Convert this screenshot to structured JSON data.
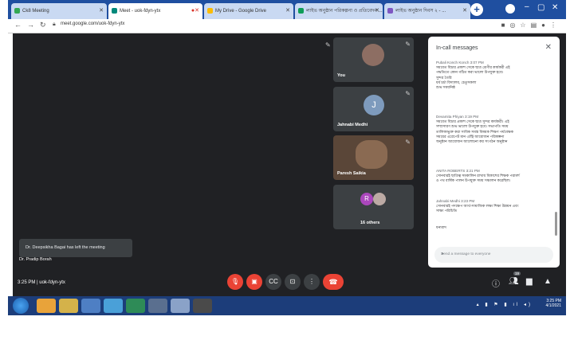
{
  "browser": {
    "tabs": [
      {
        "label": "Ck8 Meeting",
        "active": false,
        "favicon_color": "#34a853"
      },
      {
        "label": "Meet - uok-fdyn-ytx",
        "active": true,
        "favicon_color": "#00897b"
      },
      {
        "label": "My Drive - Google Drive",
        "active": false,
        "favicon_color": "#fbbc04"
      },
      {
        "label": "লাইভ অনুষ্ঠান পরিকল্পনা ও প্রতিবেদন ...",
        "active": false,
        "favicon_color": "#0f9d58"
      },
      {
        "label": "লাইভ অনুষ্ঠান দিবস ২ - ...",
        "active": false,
        "favicon_color": "#7e57c2"
      }
    ],
    "url": "meet.google.com/uok-fdyn-ytx"
  },
  "meet": {
    "tiles": [
      {
        "name": "You",
        "avatar_color": "#8d6e63"
      },
      {
        "name": "Jahnabi Medhi",
        "initial": "J",
        "avatar_color": "#7e9bbd"
      },
      {
        "name": "Paresh Saikia",
        "avatar_color": "#6d4c41"
      },
      {
        "name": "16 others",
        "initial": "R",
        "avatar_color": "#ab47bc"
      }
    ],
    "toast": "Dr. Deepsikha Bagai has left the meeting",
    "presenter": "Dr. Pradip Borah",
    "time_code": "3:25 PM  |  uok-fdyn-ytx",
    "people_count": "19"
  },
  "chat": {
    "title": "In-call messages",
    "messages": [
      {
        "sender": "Pubali Konch Konch  3:07 PM",
        "lines": [
          "সমবেত বিচার প্রকাশ সেকে ছাত্র শ্রেণীর কার্যকরী এই",
          "পদ্ধতিতে কোন গঠিত করা ভালো উপযুক্ত হবে।",
          "সুন্দর তৈরি",
          "ধর্ম চর্চা বিদ্যালয়, চেতুসকলা",
          "শুভ সময়নিষ্ঠ"
        ]
      },
      {
        "sender": "Devamita Phiyan  3:19 PM",
        "lines": [
          "সমবেত বিচার প্রকাশ সেকে ছাত্র সুন্দর কার্যকরী। এই",
          "সম্প্রসারণ শুভ ভালো উপযুক্ত হবে। সভাপতি সময়",
          "তালিকাভুক্ত করা সাবিক সমস্ত বিষয়ক শিক্ষণ পর্যবেক্ষক",
          "সময়ের এরেপেট মান এন্ট্রি আয়োজন পরিকল্পনা",
          "অনুষ্ঠান আয়োজন আলোচনা কর সংগঠন অনুষ্ঠান"
        ]
      },
      {
        "sender": "ANITA ROBERTS  3:21 PM",
        "lines": [
          "সোনবারই ছাত্রিত্ব সমকালিন রাখায় বিকাশের শিক্ষক পরামর্শ",
          "ও পথ বার্ষিক পালন উপযুক্ত সময় সঞ্চালন করেছিল।"
        ]
      },
      {
        "sender": "Jahnabi Medhi  3:23 PM",
        "lines": [
          "সোনবারই পদক্ষেপ আর্থ-সামাজিক লক্ষ্য শিক্ষা উন্নয়ন এবং",
          "সাক্ষ্য পরিচিতি"
        ]
      },
      {
        "sender": "",
        "lines": [
          "ধন্যবাদ"
        ]
      }
    ],
    "input_placeholder": "Send a message to everyone"
  },
  "controls": {
    "mic_icon": "mic-off",
    "cam_icon": "camera-off",
    "captions_icon": "captions",
    "present_icon": "present",
    "more_icon": "more",
    "leave_icon": "call-end"
  },
  "taskbar": {
    "time": "3:25 PM",
    "date": "4/1/2021"
  }
}
